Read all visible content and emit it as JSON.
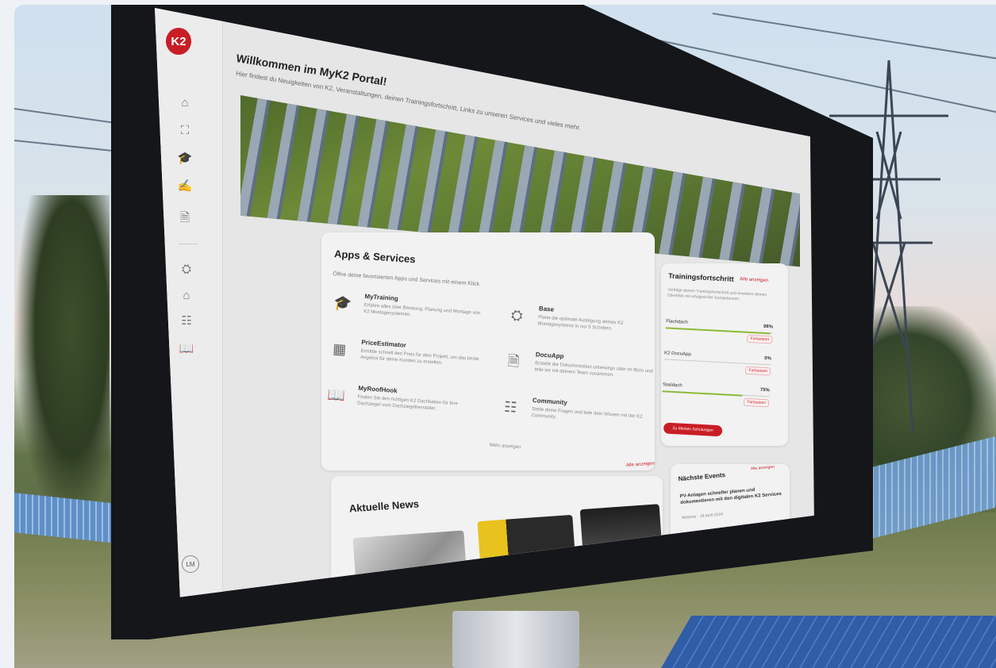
{
  "app": {
    "logo_text": "K2",
    "welcome_title": "Willkommen im MyK2 Portal!",
    "welcome_subtitle": "Hier findest du Neuigkeiten von K2, Veranstaltungen, deinen Trainingsfortschritt, Links zu unseren Services und vieles mehr."
  },
  "sidebar": {
    "items": [
      {
        "name": "home-icon",
        "glyph": "⌂"
      },
      {
        "name": "scan-icon",
        "glyph": "⛶"
      },
      {
        "name": "graduation-cap-icon",
        "glyph": "🎓"
      },
      {
        "name": "signature-icon",
        "glyph": "✍"
      },
      {
        "name": "document-icon",
        "glyph": "🗎"
      },
      {
        "name": "cube-user-icon",
        "glyph": "⛭"
      },
      {
        "name": "roof-user-icon",
        "glyph": "⌂"
      },
      {
        "name": "community-icon",
        "glyph": "☷"
      },
      {
        "name": "book-icon",
        "glyph": "📖"
      }
    ],
    "avatar": "LM"
  },
  "apps": {
    "title": "Apps & Services",
    "subtitle": "Öffne deine favorisierten Apps und Services mit einem Klick.",
    "services": [
      {
        "name": "MyTraining",
        "icon": "graduation-cap-icon",
        "glyph": "🎓",
        "desc": "Erfahre alles über Beratung, Planung und Montage von K2 Montagesystemen."
      },
      {
        "name": "Base",
        "icon": "cube-user-icon",
        "glyph": "⛭",
        "desc": "Plane die optimale Auslegung deines K2 Montagesystems in nur 5 Schritten."
      },
      {
        "name": "PriceEstimator",
        "icon": "calculator-icon",
        "glyph": "▦",
        "desc": "Ermittle schnell den Preis für dein Projekt, um das beste Angebot für deine Kunden zu erstellen."
      },
      {
        "name": "DocuApp",
        "icon": "document-icon",
        "glyph": "🗎",
        "desc": "Erstelle die Dokumentation unterwegs oder im Büro und teile sie mit deinem Team zusammen."
      },
      {
        "name": "MyRoofHook",
        "icon": "book-icon",
        "glyph": "📖",
        "desc": "Finden Sie den richtigen K2 Dachhaken für Ihre Dachziegel vom Dachziegelhersteller."
      },
      {
        "name": "Community",
        "icon": "community-icon",
        "glyph": "☷",
        "desc": "Stelle deine Fragen und teile dein Wissen mit der K2 Community."
      }
    ],
    "more": "Mehr anzeigen"
  },
  "training": {
    "title": "Trainingsfortschritt",
    "all": "Alle anzeigen",
    "desc": "Verfolge deinen Trainingsfortschritt und erweitere deinen Überblick mit erfolgreicher Kompetenzen.",
    "rows": [
      {
        "name": "Flachdach",
        "pct": "98%",
        "progress": 0.98,
        "tag": "Fortsetzen"
      },
      {
        "name": "K2 DocuApp",
        "pct": "0%",
        "progress": 0.0,
        "tag": "Fortsetzen"
      },
      {
        "name": "Steildach",
        "pct": "75%",
        "progress": 0.75,
        "tag": "Fortsetzen"
      }
    ],
    "button": "Zu Meinen Schulungen"
  },
  "news": {
    "title": "Aktuelle News",
    "all": "Alle anzeigen"
  },
  "events": {
    "title": "Nächste Events",
    "all": "Alle anzeigen",
    "event_title": "PV-Anlagen schneller planen und dokumentieren mit den digitalen K2 Services",
    "event_meta": "Webinar · 19 April 2024"
  },
  "colors": {
    "brand_red": "#c91d25",
    "progress_green": "#8dbb3a"
  }
}
